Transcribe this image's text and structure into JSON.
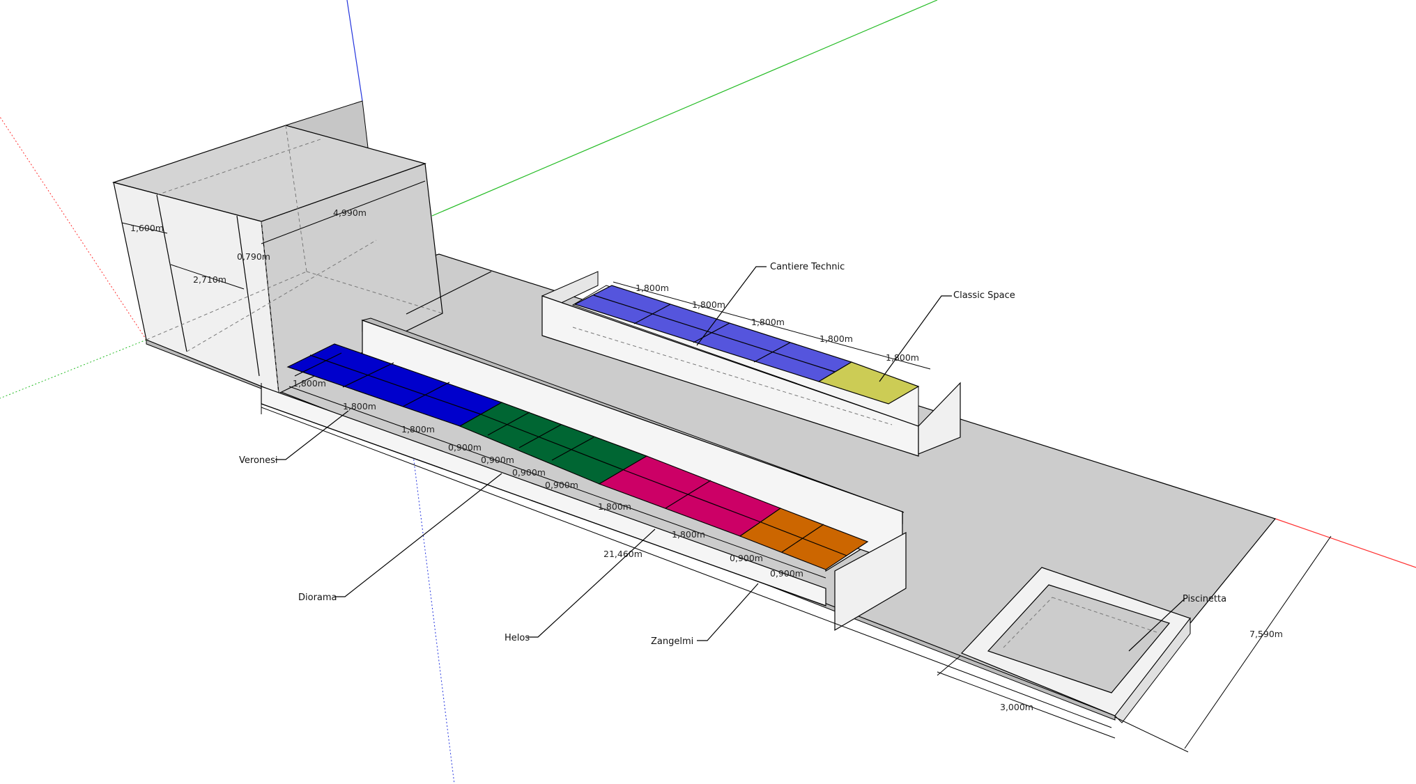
{
  "colors": {
    "floor": "#cccccc",
    "wall_front": "#f2f2f2",
    "wall_side": "#d9d9d9",
    "axis_red": "#ff3030",
    "axis_green": "#22bb22",
    "axis_blue": "#2233dd",
    "veronesi": "#0000cc",
    "diorama": "#006633",
    "helos": "#cc0066",
    "zangelmi": "#cc6600",
    "cantiere_technic": "#5555dd",
    "classic_space": "#cccc55"
  },
  "labels": {
    "veronesi": "Veronesi",
    "diorama": "Diorama",
    "helos": "Helos",
    "zangelmi": "Zangelmi",
    "cantiere_technic": "Cantiere Technic",
    "classic_space": "Classic Space",
    "piscinetta": "Piscinetta"
  },
  "dimensions": {
    "box_width": "1,600m",
    "box_inner": "2,710m",
    "box_depth": "4,990m",
    "box_wall": "0,790m",
    "total_length": "21,460m",
    "pool_width": "3,000m",
    "total_width": "7,590m",
    "seg_1800": "1,800m",
    "seg_900": "0,900m"
  }
}
